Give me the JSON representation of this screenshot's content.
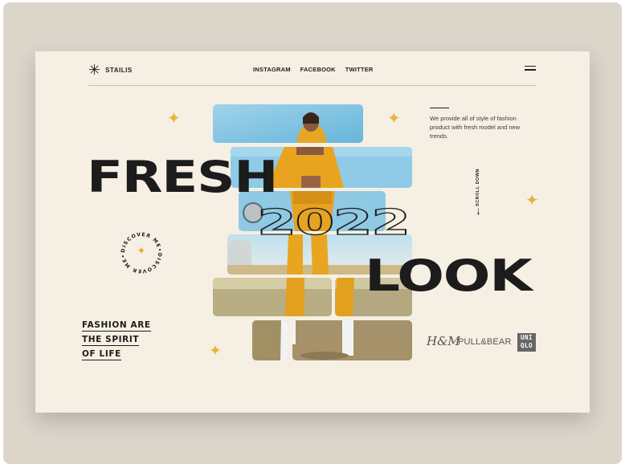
{
  "header": {
    "logo_mark": "✳",
    "logo_text": "STAILIS",
    "nav": [
      "INSTAGRAM",
      "FACEBOOK",
      "TWITTER"
    ]
  },
  "hero": {
    "word1": "FRESH",
    "year": "2022",
    "word2": "LOOK",
    "description": "We provide all of style of fashion product with fresh model and new trends.",
    "scroll_label": "SCROLL DOWN",
    "scroll_arrow": "↓",
    "badge_text": "DISCOVER ME•DISCOVER ME•"
  },
  "slogan": [
    "FASHION ARE",
    "THE SPIRIT",
    "OF LIFE"
  ],
  "brands": {
    "hm": "H&M",
    "pullbear": "PULL&BEAR",
    "uniqlo_line1": "UNI",
    "uniqlo_line2": "QLO"
  },
  "colors": {
    "background": "#dcd5ca",
    "card": "#f6efe3",
    "accent": "#e8b33a",
    "text": "#1c1c1c"
  },
  "icons": {
    "star": "✦",
    "menu": "hamburger-icon"
  }
}
